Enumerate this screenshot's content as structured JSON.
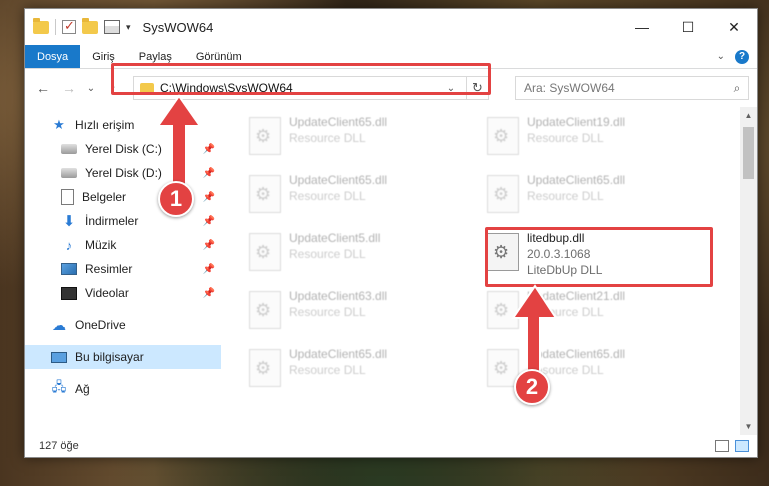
{
  "window": {
    "title": "SysWOW64",
    "minimize": "—",
    "maximize": "☐",
    "close": "✕"
  },
  "ribbon": {
    "tabs": [
      "Dosya",
      "Giriş",
      "Paylaş",
      "Görünüm"
    ],
    "help": "?"
  },
  "nav": {
    "back": "←",
    "forward": "→",
    "recent": "⌄",
    "up": "↑",
    "path": "C:\\Windows\\SysWOW64",
    "dropdown": "⌄",
    "refresh": "↻",
    "search_placeholder": "Ara: SysWOW64",
    "search_icon": "⌕"
  },
  "sidebar": {
    "items": [
      {
        "label": "Hızlı erişim",
        "icon": "star-icon"
      },
      {
        "label": "Yerel Disk (C:)",
        "icon": "disk-icon",
        "pinned": true
      },
      {
        "label": "Yerel Disk (D:)",
        "icon": "disk-icon",
        "pinned": true
      },
      {
        "label": "Belgeler",
        "icon": "document-icon",
        "pinned": true
      },
      {
        "label": "İndirmeler",
        "icon": "download-icon",
        "pinned": true
      },
      {
        "label": "Müzik",
        "icon": "music-icon",
        "pinned": true
      },
      {
        "label": "Resimler",
        "icon": "pictures-icon",
        "pinned": true
      },
      {
        "label": "Videolar",
        "icon": "video-icon",
        "pinned": true
      },
      {
        "label": "OneDrive",
        "icon": "cloud-icon"
      },
      {
        "label": "Bu bilgisayar",
        "icon": "computer-icon",
        "selected": true
      },
      {
        "label": "Ağ",
        "icon": "network-icon"
      }
    ],
    "pin_glyph": "📌"
  },
  "files": [
    {
      "name": "UpdateClient65.dll",
      "type": "Resource DLL"
    },
    {
      "name": "UpdateClient19.dll",
      "type": "Resource DLL"
    },
    {
      "name": "UpdateClient65.dll",
      "type": "Resource DLL"
    },
    {
      "name": "UpdateClient65.dll",
      "type": "Resource DLL"
    },
    {
      "name": "UpdateClient5.dll",
      "type": "Resource DLL"
    },
    {
      "name": "litedbup.dll",
      "version": "20.0.3.1068",
      "type": "LiteDbUp DLL",
      "highlighted": true
    },
    {
      "name": "UpdateClient63.dll",
      "type": "Resource DLL"
    },
    {
      "name": "UpdateClient21.dll",
      "type": "Resource DLL"
    },
    {
      "name": "UpdateClient65.dll",
      "type": "Resource DLL"
    },
    {
      "name": "UpdateClient65.dll",
      "type": "Resource DLL"
    }
  ],
  "status": {
    "count": "127 öğe"
  },
  "annotations": {
    "badge1": "1",
    "badge2": "2",
    "color": "#e34242"
  }
}
